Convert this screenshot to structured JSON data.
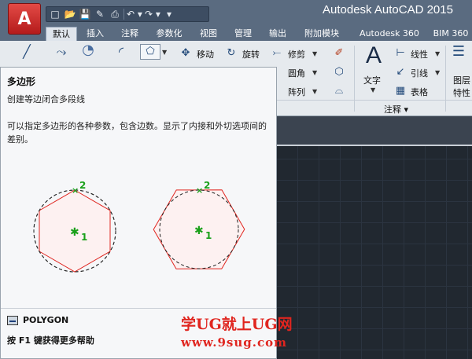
{
  "window": {
    "title": "Autodesk AutoCAD 2015",
    "app_button_glyph": "A"
  },
  "quick_access": [
    {
      "icon": "new-icon",
      "glyph": "□"
    },
    {
      "icon": "open-icon",
      "glyph": "📂"
    },
    {
      "icon": "save-icon",
      "glyph": "💾"
    },
    {
      "icon": "save-as-icon",
      "glyph": "✎"
    },
    {
      "icon": "print-icon",
      "glyph": "⎙"
    },
    {
      "icon": "undo-icon",
      "glyph": "↶ ▾"
    },
    {
      "icon": "redo-icon",
      "glyph": "↷ ▾"
    },
    {
      "icon": "customize-icon",
      "glyph": "▾"
    }
  ],
  "tabs": [
    "默认",
    "插入",
    "注释",
    "参数化",
    "视图",
    "管理",
    "输出",
    "附加模块",
    "Autodesk 360",
    "BIM 360"
  ],
  "active_tab": "默认",
  "ribbon": {
    "modify": {
      "move": "移动",
      "rotate": "旋转",
      "trim": "修剪",
      "fillet": "圆角",
      "array": "阵列"
    },
    "annotation": {
      "text": "文字",
      "linear": "线性",
      "leader": "引线",
      "table": "表格",
      "footer": "注释"
    },
    "layers": {
      "layer_props_line1": "图层",
      "layer_props_line2": "特性"
    }
  },
  "tooltip": {
    "title": "多边形",
    "subtitle": "创建等边闭合多段线",
    "description": "可以指定多边形的各种参数，包含边数。显示了内接和外切选项间的差别。",
    "command": "POLYGON",
    "help": "按 F1 键获得更多帮助",
    "diagram": {
      "point_labels": [
        "2",
        "1",
        "2",
        "1"
      ]
    }
  },
  "watermark": {
    "line1": "学UG就上UG网",
    "line2": "www.9sug.com"
  },
  "colors": {
    "titlebar": "#5a6b80",
    "ribbon": "#e6eaee",
    "canvas": "#212830",
    "polygon": "#e0251f",
    "point_marker": "#1aa01a",
    "watermark": "#e0251f"
  }
}
